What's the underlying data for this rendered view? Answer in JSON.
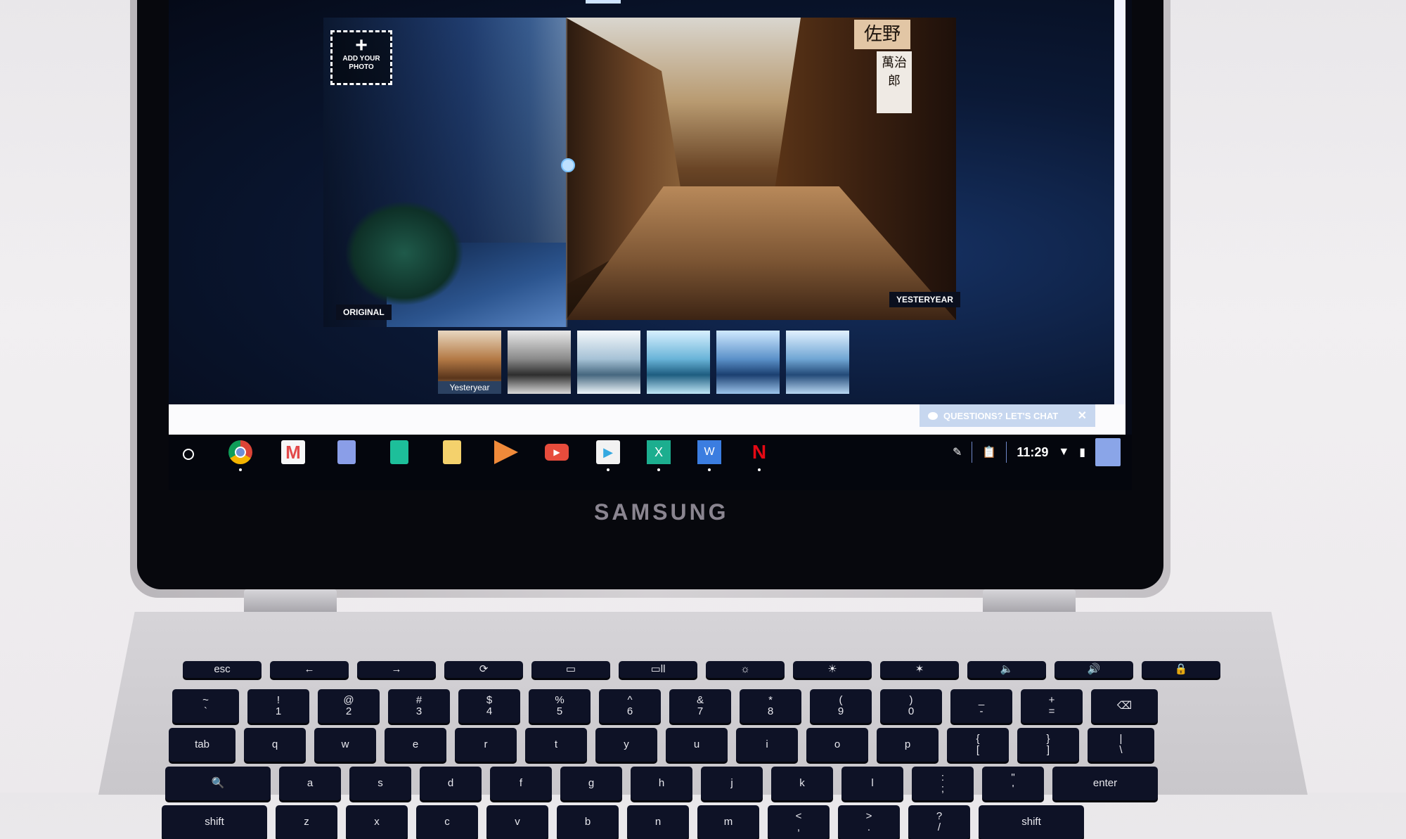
{
  "device": {
    "brand": "SAMSUNG"
  },
  "editor": {
    "add_photo": {
      "icon": "plus-icon",
      "label_line1": "ADD YOUR",
      "label_line2": "PHOTO"
    },
    "original_label": "ORIGINAL",
    "applied_filter_label": "YESTERYEAR",
    "sign_text_1": "佐野",
    "sign_text_2": "萬治郎",
    "filters": [
      {
        "name": "Yesteryear",
        "caption": "Yesteryear",
        "selected": true
      },
      {
        "name": "filter-2",
        "caption": null,
        "selected": false
      },
      {
        "name": "filter-3",
        "caption": null,
        "selected": false
      },
      {
        "name": "filter-4",
        "caption": null,
        "selected": false
      },
      {
        "name": "filter-5",
        "caption": null,
        "selected": false
      },
      {
        "name": "filter-6",
        "caption": null,
        "selected": false
      }
    ]
  },
  "chat": {
    "label": "QUESTIONS? LET'S CHAT",
    "close": "✕"
  },
  "shelf": {
    "apps": [
      {
        "name": "Chrome",
        "icon": "chrome-icon",
        "running": true
      },
      {
        "name": "Gmail",
        "icon": "gmail-icon",
        "running": false
      },
      {
        "name": "Docs",
        "icon": "docs-icon",
        "running": false
      },
      {
        "name": "Sheets",
        "icon": "sheets-icon",
        "running": false
      },
      {
        "name": "Slides",
        "icon": "slides-icon",
        "running": false
      },
      {
        "name": "Play Music",
        "icon": "play-music-icon",
        "running": false
      },
      {
        "name": "YouTube",
        "icon": "youtube-icon",
        "running": false
      },
      {
        "name": "Play Store",
        "icon": "play-store-icon",
        "running": true
      },
      {
        "name": "Excel",
        "icon": "excel-icon",
        "running": true
      },
      {
        "name": "Word",
        "icon": "word-icon",
        "running": true
      },
      {
        "name": "Netflix",
        "icon": "netflix-icon",
        "running": true
      }
    ],
    "tray": {
      "stylus_icon": "✎",
      "clipboard_icon": "📋",
      "time": "11:29",
      "wifi_icon": "▼",
      "battery_icon": "▮"
    }
  },
  "keyboard": {
    "rows": [
      [
        "esc",
        "←",
        "→",
        "⟳",
        "▭",
        "▭ll",
        "☼",
        "☀",
        "✶",
        "🔈",
        "🔊",
        "🔒"
      ],
      [
        "~ `",
        "! 1",
        "@ 2",
        "# 3",
        "$ 4",
        "% 5",
        "^ 6",
        "& 7",
        "* 8",
        "( 9",
        ") 0",
        "_ -",
        "+ =",
        "⌫"
      ],
      [
        "tab",
        "q",
        "w",
        "e",
        "r",
        "t",
        "y",
        "u",
        "i",
        "o",
        "p",
        "{ [",
        "} ]",
        "| \\"
      ],
      [
        "🔍",
        "a",
        "s",
        "d",
        "f",
        "g",
        "h",
        "j",
        "k",
        "l",
        ": ;",
        "\" '",
        "enter"
      ],
      [
        "shift",
        "z",
        "x",
        "c",
        "v",
        "b",
        "n",
        "m",
        "< ,",
        "> .",
        "? /",
        "shift"
      ]
    ]
  }
}
